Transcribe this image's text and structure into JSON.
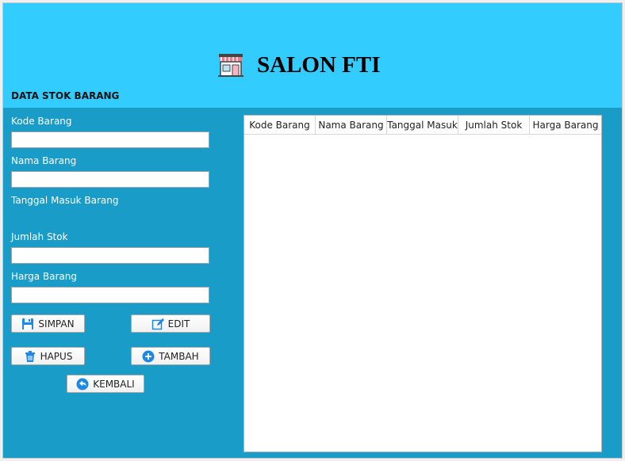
{
  "app": {
    "title": "SALON FTI",
    "section_title": "DATA STOK BARANG"
  },
  "icons": {
    "title": "store-icon",
    "save": "floppy-disk-icon",
    "edit": "edit-icon",
    "delete": "trash-icon",
    "add": "plus-circle-icon",
    "back": "back-arrow-icon"
  },
  "colors": {
    "header_bg": "#33ccff",
    "body_bg": "#1a9cc9",
    "accent_blue": "#1e88e5"
  },
  "form": {
    "kode_label": "Kode Barang",
    "kode_value": "",
    "nama_label": "Nama Barang",
    "nama_value": "",
    "tanggal_label": "Tanggal Masuk Barang",
    "jumlah_label": "Jumlah Stok",
    "jumlah_value": "",
    "harga_label": "Harga Barang",
    "harga_value": ""
  },
  "buttons": {
    "simpan": "SIMPAN",
    "edit": "EDIT",
    "hapus": "HAPUS",
    "tambah": "TAMBAH",
    "kembali": "KEMBALI"
  },
  "table": {
    "columns": [
      "Kode Barang",
      "Nama Barang",
      "Tanggal Masuk",
      "Jumlah Stok",
      "Harga Barang"
    ],
    "rows": []
  }
}
